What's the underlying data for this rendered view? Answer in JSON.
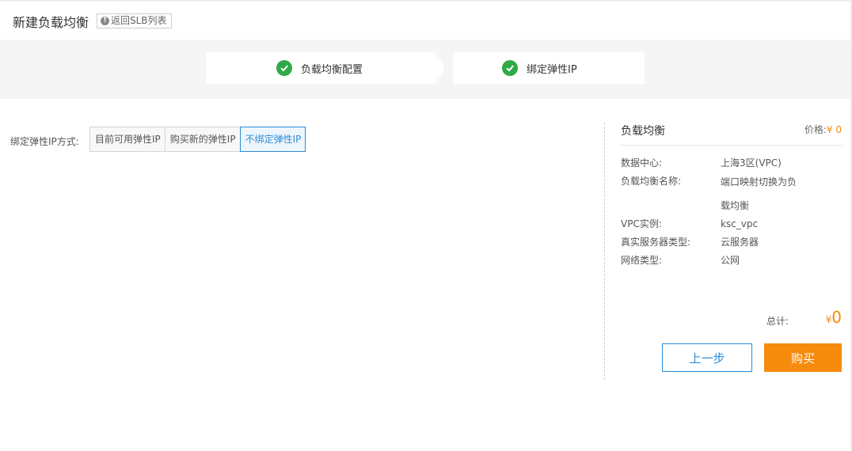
{
  "header": {
    "title": "新建负载均衡",
    "back_label": "返回SLB列表"
  },
  "steps": [
    {
      "label": "负载均衡配置",
      "status": "done"
    },
    {
      "label": "绑定弹性IP",
      "status": "done"
    }
  ],
  "bind": {
    "label": "绑定弹性IP方式:",
    "options": [
      "目前可用弹性IP",
      "购买新的弹性IP",
      "不绑定弹性IP"
    ],
    "selected": "不绑定弹性IP"
  },
  "summary": {
    "title": "负载均衡",
    "price_label": "价格:",
    "price_value": "¥ 0",
    "rows": [
      {
        "key": "数据中心:",
        "value": "上海3区(VPC)"
      },
      {
        "key": "负载均衡名称:",
        "value": "端口映射切换为负载均衡"
      },
      {
        "key": "VPC实例:",
        "value": "ksc_vpc"
      },
      {
        "key": "真实服务器类型:",
        "value": "云服务器"
      },
      {
        "key": "网络类型:",
        "value": "公网"
      }
    ],
    "total_label": "总计:",
    "total_currency": "¥",
    "total_value": "0"
  },
  "actions": {
    "prev_label": "上一步",
    "buy_label": "购买"
  },
  "colors": {
    "accent_blue": "#2b8cd8",
    "accent_orange": "#f78b0d",
    "success_green": "#2eab47"
  }
}
